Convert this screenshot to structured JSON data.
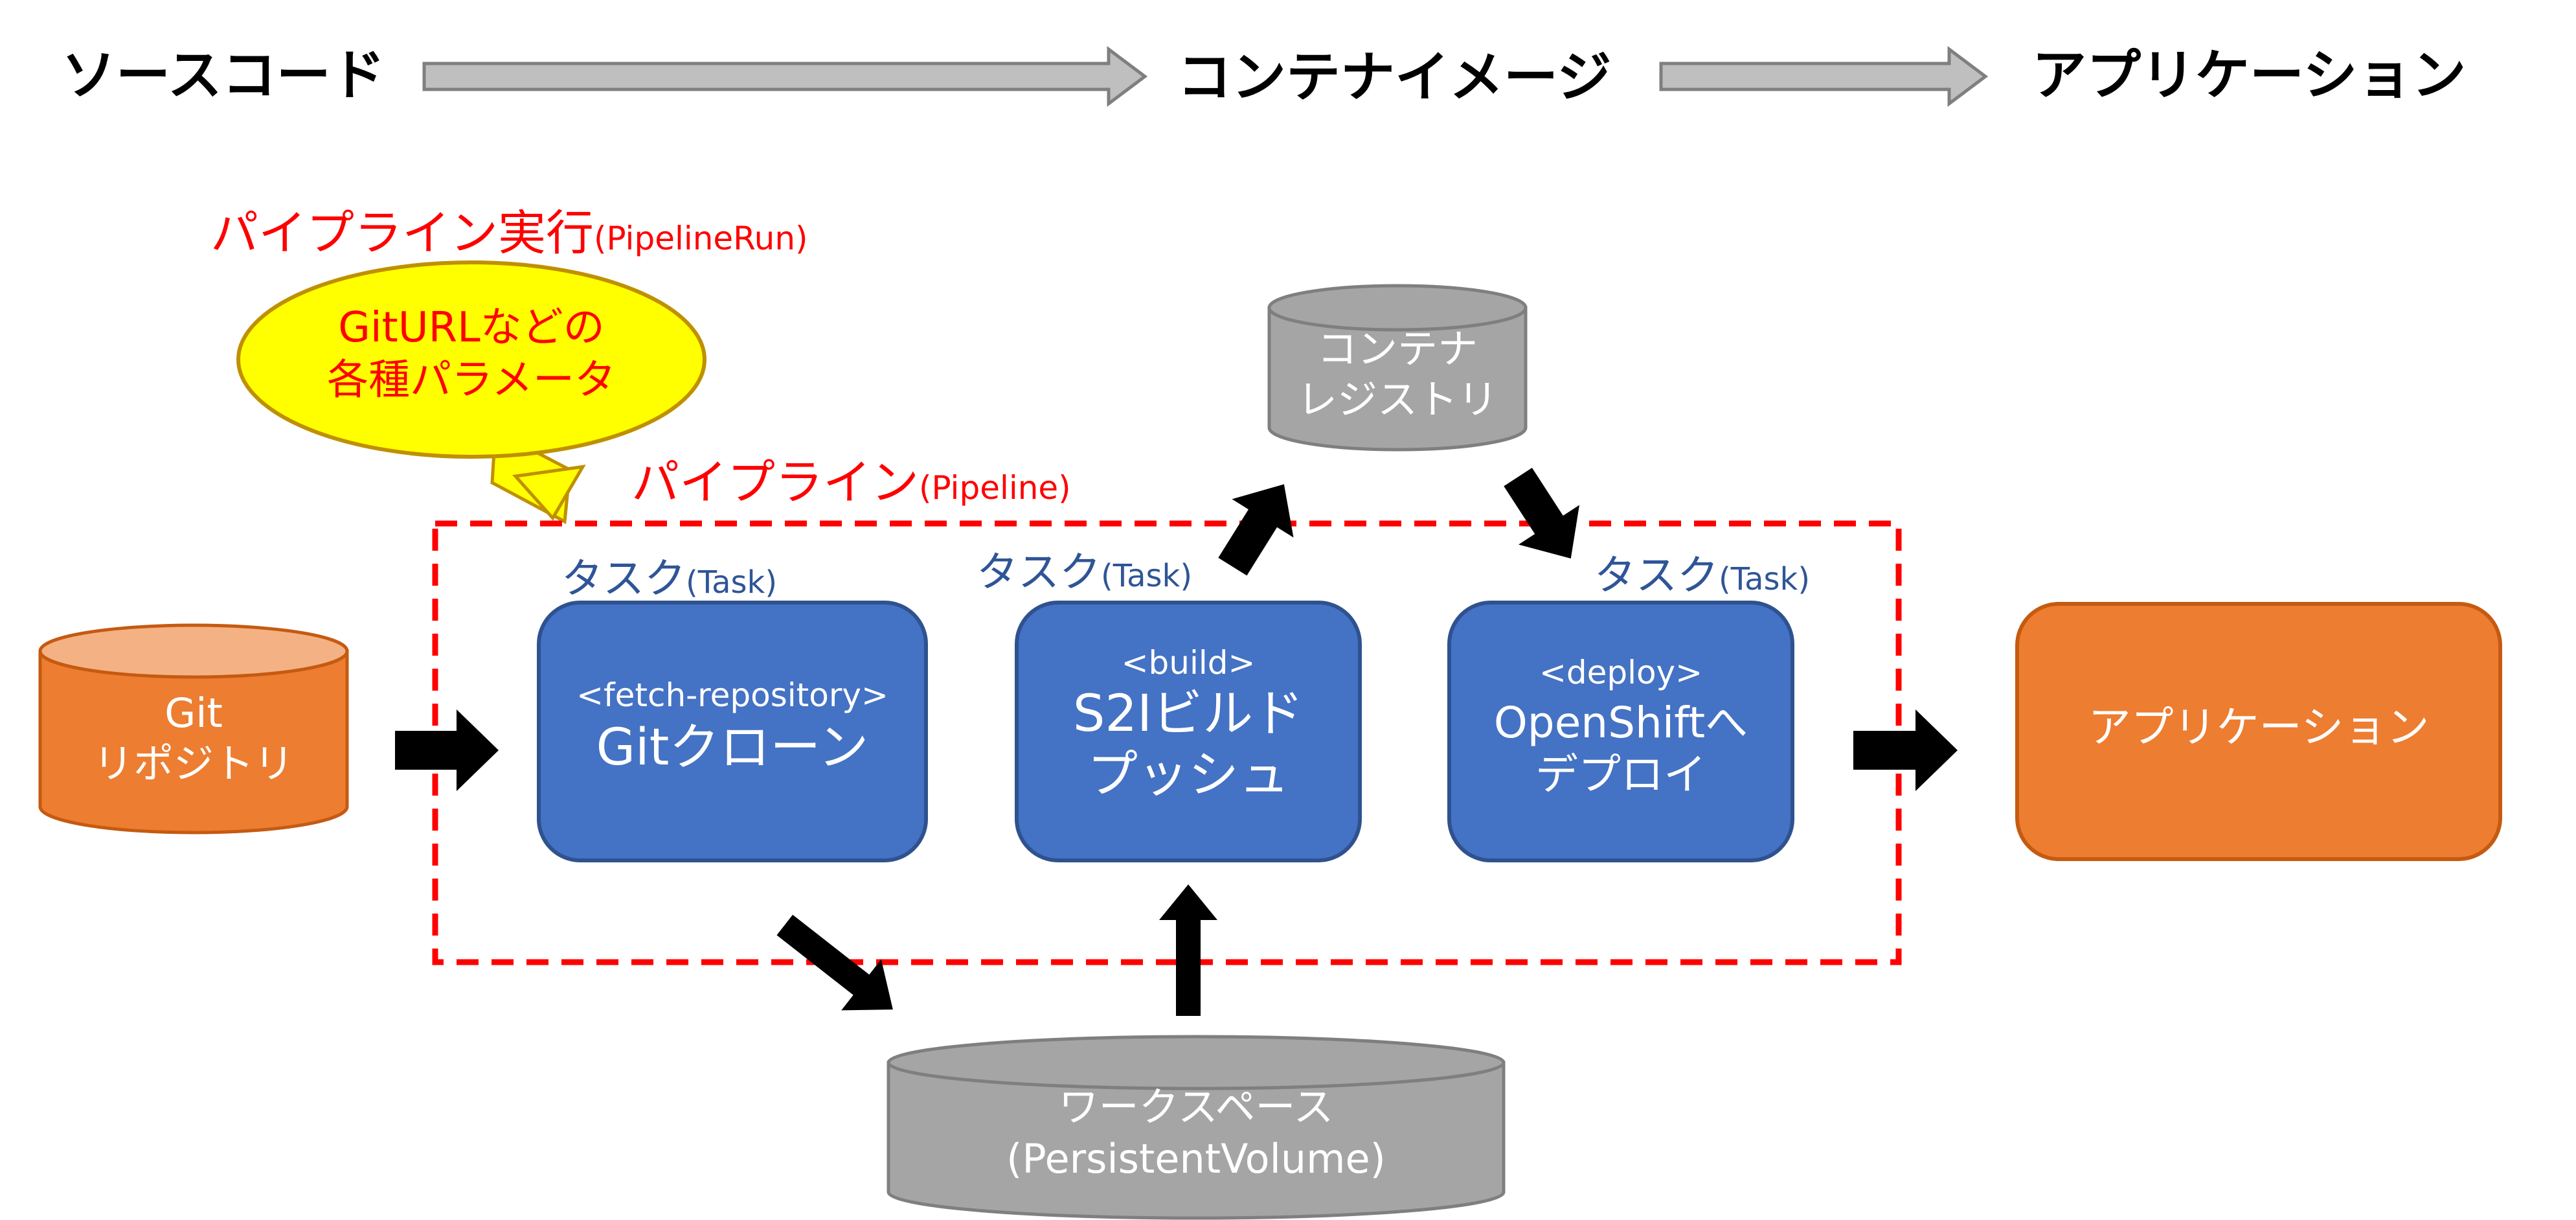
{
  "header": {
    "source_code": "ソースコード",
    "container_image": "コンテナイメージ",
    "application": "アプリケーション"
  },
  "pipeline_run": {
    "label_ja": "パイプライン実行",
    "label_en": "(PipelineRun)",
    "params_line1": "GitURLなどの",
    "params_line2": "各種パラメータ"
  },
  "pipeline": {
    "label_ja": "パイプライン",
    "label_en": "(Pipeline)"
  },
  "task_label": {
    "ja": "タスク",
    "en": "(Task)"
  },
  "tasks": [
    {
      "tag": "<fetch-repository>",
      "line1": "Gitクローン",
      "line2": ""
    },
    {
      "tag": "<build>",
      "line1": "S2Iビルド",
      "line2": "プッシュ"
    },
    {
      "tag": "<deploy>",
      "line1": "OpenShiftへ",
      "line2": "デプロイ"
    }
  ],
  "git_repo": {
    "line1": "Git",
    "line2": "リポジトリ"
  },
  "registry": {
    "line1": "コンテナ",
    "line2": "レジストリ"
  },
  "workspace": {
    "line1": "ワークスペース",
    "line2": "(PersistentVolume)"
  },
  "app_box": {
    "label": "アプリケーション"
  },
  "colors": {
    "task_fill": "#4472c4",
    "task_stroke": "#2f528f",
    "orange": "#ed7d31",
    "orange_top": "#f4b183",
    "gray": "#a5a5a5",
    "gray_dark": "#7f7f7f",
    "pipeline_border": "#ff0000",
    "callout_fill": "#ffff00",
    "task_label": "#2f5597"
  }
}
